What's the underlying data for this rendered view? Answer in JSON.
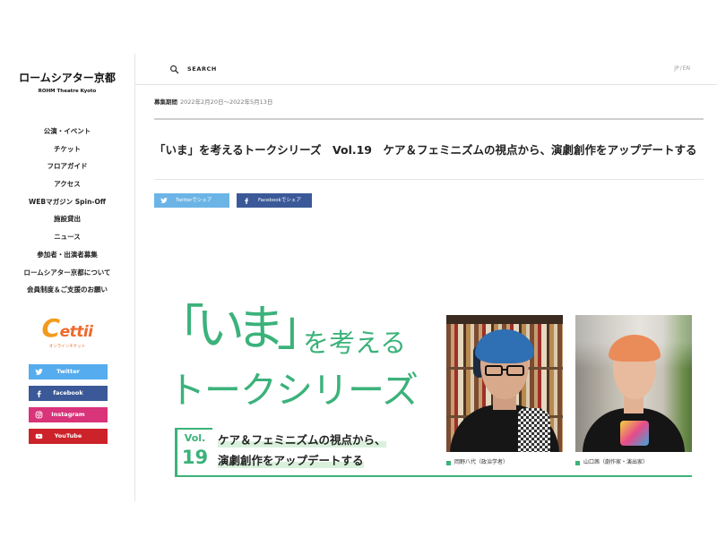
{
  "site": {
    "logo_ja": "ロームシアター京都",
    "logo_en": "ROHM Theatre Kyoto"
  },
  "nav": {
    "items": [
      "公演・イベント",
      "チケット",
      "フロアガイド",
      "アクセス",
      "WEBマガジン Spin-Off",
      "施設貸出",
      "ニュース",
      "参加者・出演者募集",
      "ロームシアター京都について",
      "会員制度＆ご支援のお願い"
    ]
  },
  "ticket_banner": {
    "logo_text": "Cettii",
    "subtext": "オンラインチケット"
  },
  "social": [
    {
      "label": "Twitter",
      "icon": "twitter-icon"
    },
    {
      "label": "facebook",
      "icon": "facebook-icon"
    },
    {
      "label": "Instagram",
      "icon": "instagram-icon"
    },
    {
      "label": "YouTube",
      "icon": "youtube-icon"
    }
  ],
  "header": {
    "search_icon": "search-icon",
    "search_label": "SEARCH",
    "languages": [
      "JP",
      "EN"
    ],
    "lang_separator": "/"
  },
  "article": {
    "period_label": "募集期間",
    "period_value": "2022年2月20日～2022年5月13日",
    "title": "「いま」を考えるトークシリーズ　Vol.19　ケア＆フェミニズムの視点から、演劇創作をアップデートする",
    "share": [
      {
        "label": "Twitterでシェア",
        "icon": "twitter-icon"
      },
      {
        "label": "Facebookでシェア",
        "icon": "facebook-icon"
      }
    ]
  },
  "hero": {
    "title_quote": "「いま」",
    "title_rest": "を考える",
    "title_line2": "トークシリーズ",
    "vol_label": "Vol.",
    "vol_number": "19",
    "subtitle_line1": "ケア＆フェミニズムの視点から、",
    "subtitle_line2": "演劇創作をアップデートする",
    "speakers": [
      {
        "caption": "岡野八代（政治学者）"
      },
      {
        "caption": "山口茜（劇作家・演出家）"
      }
    ]
  },
  "colors": {
    "accent_green": "#3bb27a",
    "highlight": "#d9f1dc",
    "twitter": "#55acee",
    "facebook": "#3b5998",
    "instagram": "#d9337a",
    "youtube": "#cc2229",
    "share_twitter": "#6cb4e6",
    "share_facebook": "#3b5998",
    "ticket_logo": "#ee6a2b"
  }
}
